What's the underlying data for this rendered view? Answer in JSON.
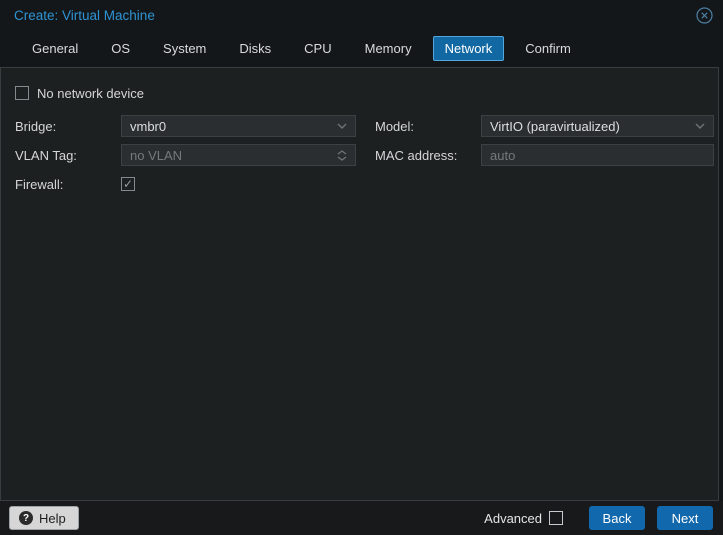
{
  "window": {
    "title": "Create: Virtual Machine"
  },
  "tabs": [
    {
      "label": "General",
      "active": false
    },
    {
      "label": "OS",
      "active": false
    },
    {
      "label": "System",
      "active": false
    },
    {
      "label": "Disks",
      "active": false
    },
    {
      "label": "CPU",
      "active": false
    },
    {
      "label": "Memory",
      "active": false
    },
    {
      "label": "Network",
      "active": true
    },
    {
      "label": "Confirm",
      "active": false
    }
  ],
  "form": {
    "no_network_device": {
      "label": "No network device",
      "checked": false
    },
    "bridge": {
      "label": "Bridge:",
      "value": "vmbr0"
    },
    "vlan_tag": {
      "label": "VLAN Tag:",
      "placeholder": "no VLAN"
    },
    "firewall": {
      "label": "Firewall:",
      "checked": true
    },
    "model": {
      "label": "Model:",
      "value": "VirtIO (paravirtualized)"
    },
    "mac_address": {
      "label": "MAC address:",
      "placeholder": "auto"
    }
  },
  "footer": {
    "help_label": "Help",
    "help_icon_glyph": "?",
    "advanced_label": "Advanced",
    "advanced_checked": false,
    "back_label": "Back",
    "next_label": "Next"
  },
  "colors": {
    "title_blue": "#2e93d4",
    "active_tab_bg": "#1268a3",
    "active_tab_border": "#54a7dc",
    "button_blue": "#1268ad",
    "content_bg": "#1d2021",
    "field_bg": "#2b2e31"
  }
}
